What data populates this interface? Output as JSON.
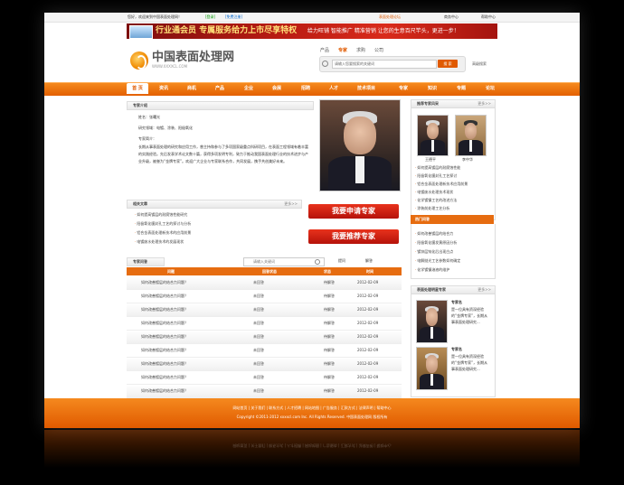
{
  "topbar": {
    "welcome": "您好，欢迎来到中国表面处理网！",
    "login": "[登录]",
    "register": "[免费注册]",
    "right_links": [
      "表面处理论坛",
      "商务中心",
      "帮助中心"
    ]
  },
  "banner": {
    "main": "行业通会员 专属服务给力上市尽享特权",
    "sub": "给力旺铺 智能推广 精准营销 让您的生意百尺竿头，更进一步！"
  },
  "logo": {
    "text": "中国表面处理网",
    "sub": "WWW.XXXXCL.COM"
  },
  "search": {
    "tabs": [
      "产品",
      "专家",
      "求购",
      "公司"
    ],
    "placeholder": "请输入您要搜索的关键词",
    "button": "搜 索",
    "advanced": "高级搜索"
  },
  "nav": {
    "items": [
      "首 页",
      "资讯",
      "商机",
      "产品",
      "企业",
      "会展",
      "招聘",
      "人才",
      "技术项目",
      "专家",
      "知识",
      "专题",
      "论坛"
    ]
  },
  "expert": {
    "panel_title": "专家介绍",
    "name_line": "姓名：张曙光",
    "field_line": "研究领域：电镀、涂装、阳极氧化",
    "title_line": "专家简介：",
    "body": "长期从事表面处理的研究和应用工作，曾主持和参与了多项国家级重点科研项目，在表面工程领域有着丰富的实践经验。先后发表学术论文数十篇，获得多项发明专利，致力于推动我国表面处理行业的技术进步与产业升级，被誉为“金牌专家”。欢迎广大企业与专家联系合作，共同发展，携手共创美好未来。",
    "more": "更多>>"
  },
  "related": {
    "title": "相关文章",
    "more": "更多>>",
    "items": [
      "如何提高镀层的耐腐蚀性能研究",
      "阳极氧化膜封孔工艺的探讨与分析",
      "铝合金表面处理新技术的应用前景",
      "电镀废水处理技术的发展现状"
    ]
  },
  "buttons": {
    "apply": "我要申请专家",
    "recommend": "我要推荐专家"
  },
  "qa": {
    "tab": "专家问答",
    "search_placeholder": "请输入关键词",
    "tabs": [
      "提问",
      "解答"
    ],
    "columns": [
      "问题",
      "回答状态",
      "状态",
      "时间"
    ],
    "rows": [
      {
        "q": "如何改善镀层的结合力问题？",
        "a": "未回答",
        "s": "待解答",
        "t": "2012-02-09"
      },
      {
        "q": "如何改善镀层的结合力问题？",
        "a": "未回答",
        "s": "待解答",
        "t": "2012-02-09"
      },
      {
        "q": "如何改善镀层的结合力问题？",
        "a": "未回答",
        "s": "待解答",
        "t": "2012-02-09"
      },
      {
        "q": "如何改善镀层的结合力问题？",
        "a": "未回答",
        "s": "待解答",
        "t": "2012-02-09"
      },
      {
        "q": "如何改善镀层的结合力问题？",
        "a": "未回答",
        "s": "待解答",
        "t": "2012-02-09"
      },
      {
        "q": "如何改善镀层的结合力问题？",
        "a": "未回答",
        "s": "待解答",
        "t": "2012-02-09"
      },
      {
        "q": "如何改善镀层的结合力问题？",
        "a": "未回答",
        "s": "待解答",
        "t": "2012-02-09"
      },
      {
        "q": "如何改善镀层的结合力问题？",
        "a": "未回答",
        "s": "待解答",
        "t": "2012-02-09"
      },
      {
        "q": "如何改善镀层的结合力问题？",
        "a": "未回答",
        "s": "待解答",
        "t": "2012-02-09"
      }
    ]
  },
  "recommend_experts": {
    "title": "推荐专家风采",
    "more": "更多>>",
    "names": [
      "王德平",
      "李中华"
    ],
    "items": [
      "如何提高镀层的耐腐蚀性能",
      "阳极氧化膜封孔工艺探讨",
      "铝合金表面处理新技术应用前景",
      "电镀废水处理技术现状",
      "化学镀镍工艺的改进方法",
      "涂装前处理工艺分析"
    ]
  },
  "hot": {
    "title": "热门问答",
    "items": [
      "如何改善镀层的结合力",
      "阳极氧化膜发黄原因分析",
      "镀锌层钝化后出现白点",
      "电解抛光工艺参数如何确定",
      "化学镀镍溶液的维护"
    ]
  },
  "star": {
    "title": "表面处理明星专家",
    "more": "更多>>",
    "experts": [
      {
        "name": "专家名",
        "desc": "是一位具有资深经验的“金牌专家”，长期从事表面处理研究..."
      },
      {
        "name": "专家名",
        "desc": "是一位具有资深经验的“金牌专家”，长期从事表面处理研究..."
      }
    ]
  },
  "footer": {
    "links": "网站首页 | 关于我们 | 联系方式 | 人才招聘 | 网站地图 | 广告服务 | 汇款方式 | 法律声明 | 帮助中心",
    "copy": "Copyright ©2011-2012 xxxxcl.com Inc. All Rights Reserved. 中国表面处理网 版权所有"
  }
}
